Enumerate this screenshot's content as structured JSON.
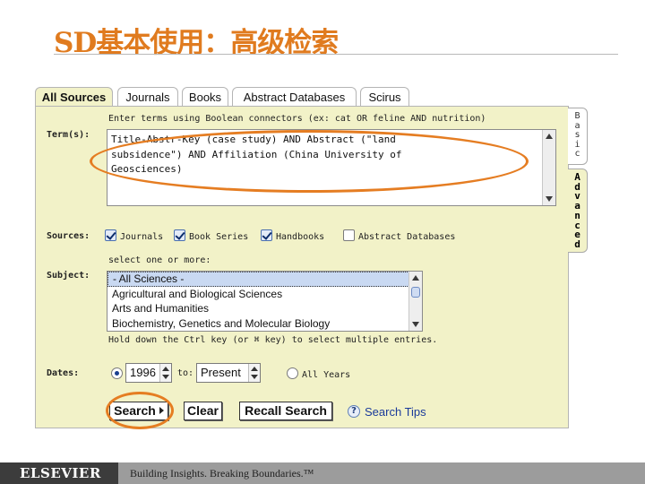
{
  "slide": {
    "title": "SD基本使用：高级检索"
  },
  "tabs": [
    {
      "label": "All Sources",
      "active": true
    },
    {
      "label": "Journals"
    },
    {
      "label": "Books"
    },
    {
      "label": "Abstract Databases"
    },
    {
      "label": "Scirus"
    }
  ],
  "side_tabs": {
    "basic": "B\na\ns\ni\nc",
    "advanced": "A\nd\nv\na\nn\nc\ne\nd"
  },
  "term": {
    "label": "Term(s):",
    "hint": "Enter terms using Boolean connectors (ex: cat OR feline AND nutrition)",
    "value": "Title-Abstr-Key (case study) AND Abstract (\"land\nsubsidence\") AND Affiliation (China University of\nGeosciences)"
  },
  "sources": {
    "label": "Sources:",
    "options": [
      {
        "label": "Journals",
        "checked": true
      },
      {
        "label": "Book Series",
        "checked": true
      },
      {
        "label": "Handbooks",
        "checked": true
      },
      {
        "label": "Abstract Databases",
        "checked": false
      }
    ]
  },
  "subject": {
    "label": "Subject:",
    "hint": "select one or more:",
    "items": [
      "- All Sciences -",
      "Agricultural and Biological Sciences",
      "Arts and Humanities",
      "Biochemistry, Genetics and Molecular Biology"
    ],
    "note": "Hold down the Ctrl key (or ⌘ key) to select multiple entries."
  },
  "dates": {
    "label": "Dates:",
    "from": "1996",
    "to_label": "to:",
    "to": "Present",
    "all_years": "All Years"
  },
  "buttons": {
    "search": "Search",
    "clear": "Clear",
    "recall": "Recall Search",
    "tips": "Search Tips",
    "tips_icon": "?"
  },
  "footer": {
    "logo": "ELSEVIER",
    "tagline": "Building Insights. Breaking Boundaries.™"
  },
  "colors": {
    "accent": "#e07b1f",
    "panel": "#f2f2c8",
    "link": "#1a3a9a"
  }
}
